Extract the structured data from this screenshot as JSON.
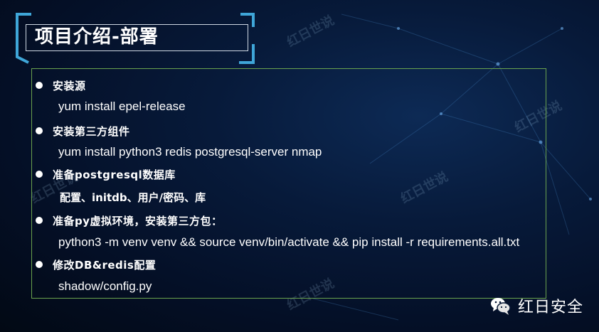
{
  "slide": {
    "title": "项目介绍-部署",
    "items": [
      {
        "heading": "安装源",
        "detail": "yum install epel-release"
      },
      {
        "heading": "安装第三方组件",
        "detail": "yum install python3 redis postgresql-server nmap"
      },
      {
        "heading": "准备postgresql数据库",
        "detail": "配置、initdb、用户/密码、库"
      },
      {
        "heading": "准备py虚拟环境，安装第三方包：",
        "detail": "python3 -m venv venv && source venv/bin/activate && pip install -r requirements.all.txt"
      },
      {
        "heading": "修改DB&redis配置",
        "detail": "shadow/config.py"
      }
    ]
  },
  "watermark": {
    "text": "红日世说"
  },
  "brand": {
    "name": "红日安全",
    "icon": "wechat-icon"
  },
  "colors": {
    "background": "#061633",
    "title_accent": "#3fa6d8",
    "content_border": "#6aa34e",
    "text": "#ffffff"
  }
}
